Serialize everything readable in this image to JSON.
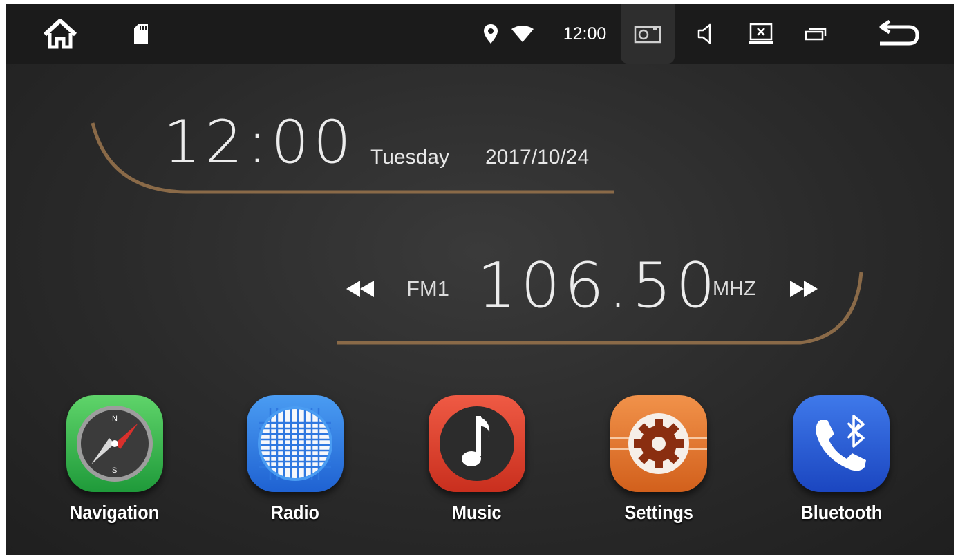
{
  "status_bar": {
    "icons": [
      "home-icon",
      "sd-card-icon",
      "location-icon",
      "wifi-icon",
      "camera-icon",
      "volume-icon",
      "screen-off-icon",
      "recent-apps-icon",
      "back-icon"
    ],
    "time": "12:00"
  },
  "clock": {
    "time": "12:00",
    "day": "Tuesday",
    "date": "2017/10/24"
  },
  "radio": {
    "band": "FM1",
    "frequency": "106.50",
    "unit": "MHZ"
  },
  "apps": [
    {
      "label": "Navigation",
      "icon": "compass-icon",
      "color": "#2fb34a"
    },
    {
      "label": "Radio",
      "icon": "radio-icon",
      "color": "#2e7fe6"
    },
    {
      "label": "Music",
      "icon": "music-note-icon",
      "color": "#e0402c"
    },
    {
      "label": "Settings",
      "icon": "gear-icon",
      "color": "#e8732a"
    },
    {
      "label": "Bluetooth",
      "icon": "bluetooth-phone-icon",
      "color": "#2a5fd8"
    }
  ],
  "colors": {
    "accent_bronze": "#8a6a48",
    "background": "#2a2a2a",
    "statusbar": "#1b1b1b"
  }
}
